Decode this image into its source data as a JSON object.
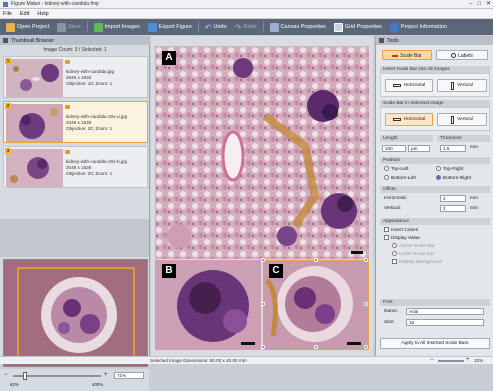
{
  "window": {
    "title": "Figure Maker - kidney-with-candida.fmp",
    "controls": [
      "–",
      "□",
      "✕"
    ]
  },
  "menu": [
    "File",
    "Edit",
    "Help"
  ],
  "toolbar": {
    "items": [
      {
        "label": "Open Project",
        "icon": "folder-open-icon",
        "enabled": true
      },
      {
        "label": "Save",
        "icon": "save-icon",
        "enabled": false
      },
      {
        "label": "Import Images",
        "icon": "import-images-icon",
        "enabled": true
      },
      {
        "label": "Export Figure",
        "icon": "export-figure-icon",
        "enabled": true
      },
      {
        "label": "Undo",
        "icon": "undo-icon",
        "enabled": true
      },
      {
        "label": "Redo",
        "icon": "redo-icon",
        "enabled": false
      },
      {
        "label": "Canvas Properties",
        "icon": "canvas-properties-icon",
        "enabled": true
      },
      {
        "label": "Grid Properties",
        "icon": "grid-properties-icon",
        "enabled": true
      },
      {
        "label": "Project Information",
        "icon": "project-info-icon",
        "enabled": true
      }
    ]
  },
  "thumbnail_browser": {
    "title": "Thumbnail Browser",
    "count_text": "Image Count: 3 / Selected: 1",
    "items": [
      {
        "index": "1",
        "name": "kidney-with-candida.jpg",
        "size": "4946 x 4630",
        "meta": "Objective: 10; Zoom: 1",
        "selected": false
      },
      {
        "index": "2",
        "name": "kidney-with-candida-20x-a.jpg",
        "size": "2048 x 1536",
        "meta": "Objective: 20; Zoom: 1",
        "selected": true
      },
      {
        "index": "3",
        "name": "kidney-with-candida-20x-b.jpg",
        "size": "2048 x 1536",
        "meta": "Objective: 20; Zoom: 1",
        "selected": false
      }
    ]
  },
  "zoom": {
    "value": "71%",
    "min_label": "62%",
    "max_label": "400%",
    "level": 0.12
  },
  "canvas": {
    "panels": [
      {
        "label": "A"
      },
      {
        "label": "B"
      },
      {
        "label": "C"
      }
    ]
  },
  "status": {
    "dimensions": "Selected Image Dimensions: 50.00 x 40.00 mm",
    "zoom": "33%"
  },
  "tools": {
    "title": "Tools",
    "tabs": [
      {
        "label": "Scale Bar",
        "active": true
      },
      {
        "label": "Labels",
        "active": false
      }
    ],
    "insert_all": {
      "header": "Insert Scale Bar into All Images",
      "horizontal": "Horizontal",
      "vertical": "Vertical"
    },
    "insert_selected": {
      "header": "Scale Bar in Selected Image",
      "horizontal": "Horizontal",
      "vertical": "Vertical"
    },
    "length": {
      "header": "Length",
      "value": "100",
      "unit": "µm"
    },
    "thickness": {
      "header": "Thickness",
      "value": "1.5",
      "unit": "mm"
    },
    "position": {
      "header": "Position",
      "options": [
        {
          "label": "Top-Left",
          "checked": false
        },
        {
          "label": "Top-Right",
          "checked": false
        },
        {
          "label": "Bottom-Left",
          "checked": false
        },
        {
          "label": "Bottom-Right",
          "checked": true
        }
      ]
    },
    "offset": {
      "header": "Offset",
      "horizontal_label": "Horizontal:",
      "horizontal_value": "2",
      "vertical_label": "Vertical:",
      "vertical_value": "2",
      "unit": "mm"
    },
    "appearance": {
      "header": "Appearance",
      "invert": "Invert Colors",
      "display_value": "Display Value",
      "above": "Above Scale Bar",
      "under": "Under Scale Bar",
      "display_bg": "Display Background"
    },
    "font": {
      "header": "Font",
      "name_label": "Name:",
      "name_value": "Arial",
      "size_label": "Size:",
      "size_value": "16"
    },
    "apply_button": "Apply to All Inserted Scale Bars"
  },
  "colors": {
    "accent": "#e6a24a",
    "toolbar": "#5b6778",
    "label_bg": "#000000"
  }
}
